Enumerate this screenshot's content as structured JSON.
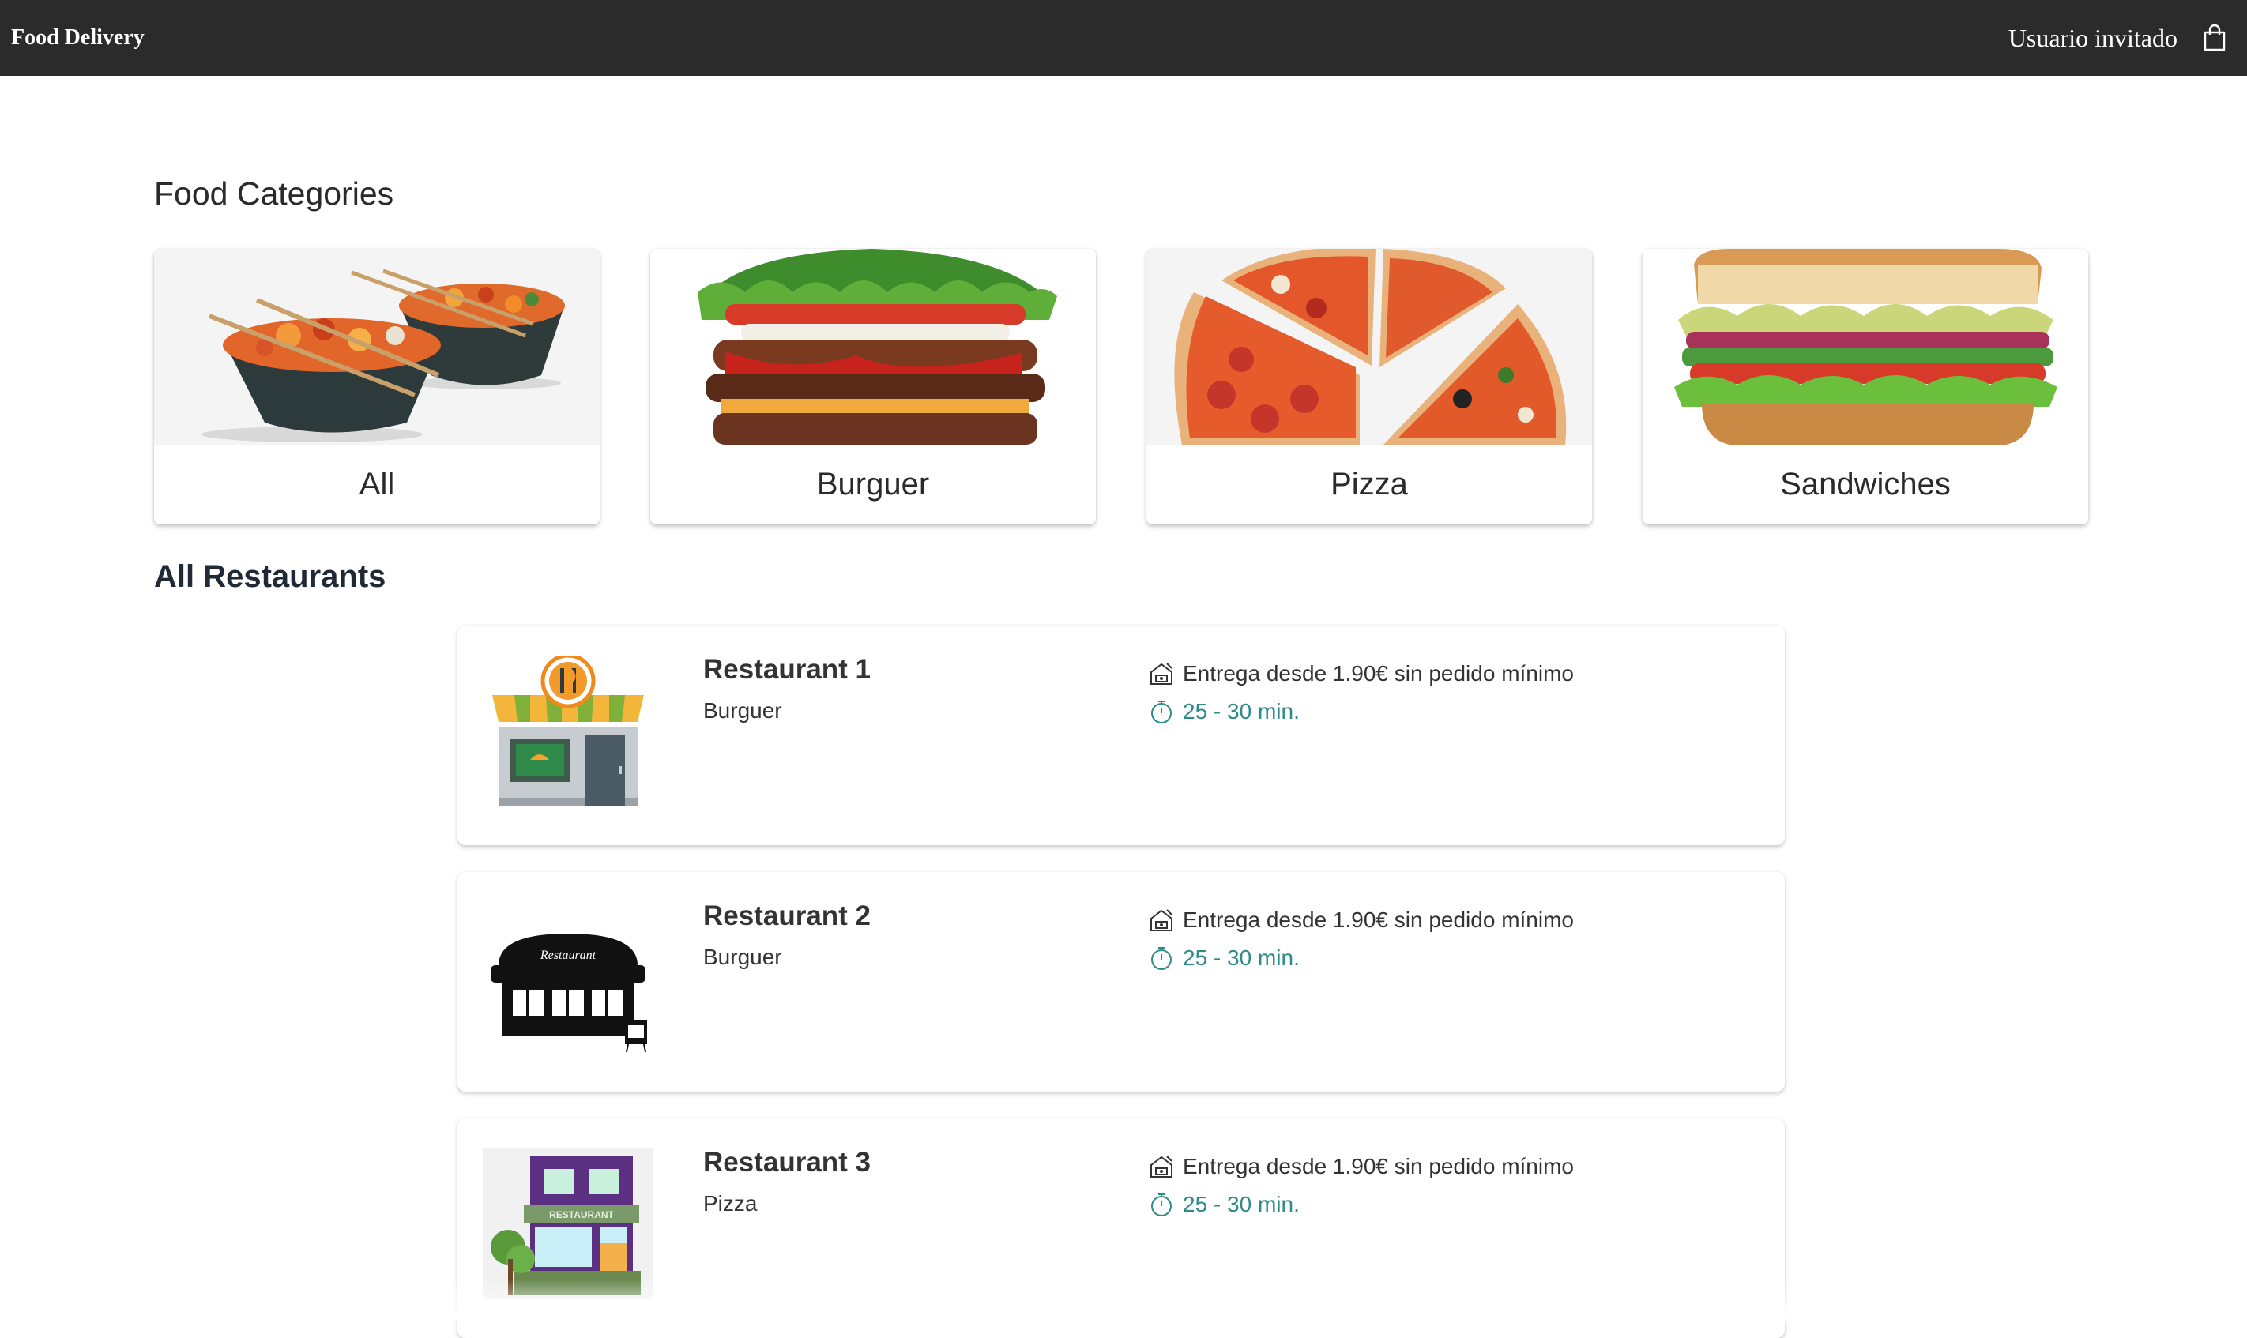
{
  "header": {
    "brand": "Food Delivery",
    "user_label": "Usuario invitado",
    "cart_icon": "shopping-bag-icon"
  },
  "categories_section": {
    "title": "Food Categories",
    "items": [
      {
        "label": "All",
        "image": "noodle-bowls-image"
      },
      {
        "label": "Burguer",
        "image": "burger-image"
      },
      {
        "label": "Pizza",
        "image": "pizza-slices-image"
      },
      {
        "label": "Sandwiches",
        "image": "sandwich-image"
      }
    ]
  },
  "restaurants_section": {
    "title": "All Restaurants",
    "items": [
      {
        "name": "Restaurant 1",
        "category": "Burguer",
        "delivery": "Entrega desde 1.90€ sin pedido mínimo",
        "time": "25 - 30 min.",
        "logo": "storefront-awning-icon"
      },
      {
        "name": "Restaurant 2",
        "category": "Burguer",
        "delivery": "Entrega desde 1.90€ sin pedido mínimo",
        "time": "25 - 30 min.",
        "logo": "restaurant-silhouette-icon",
        "logo_text": "Restaurant"
      },
      {
        "name": "Restaurant 3",
        "category": "Pizza",
        "delivery": "Entrega desde 1.90€ sin pedido mínimo",
        "time": "25 - 30 min.",
        "logo": "purple-restaurant-building-icon",
        "logo_text": "RESTAURANT"
      }
    ]
  },
  "colors": {
    "header_bg": "#2b2b2b",
    "accent_teal": "#2e8b89",
    "heading_dark": "#1f2a36"
  }
}
